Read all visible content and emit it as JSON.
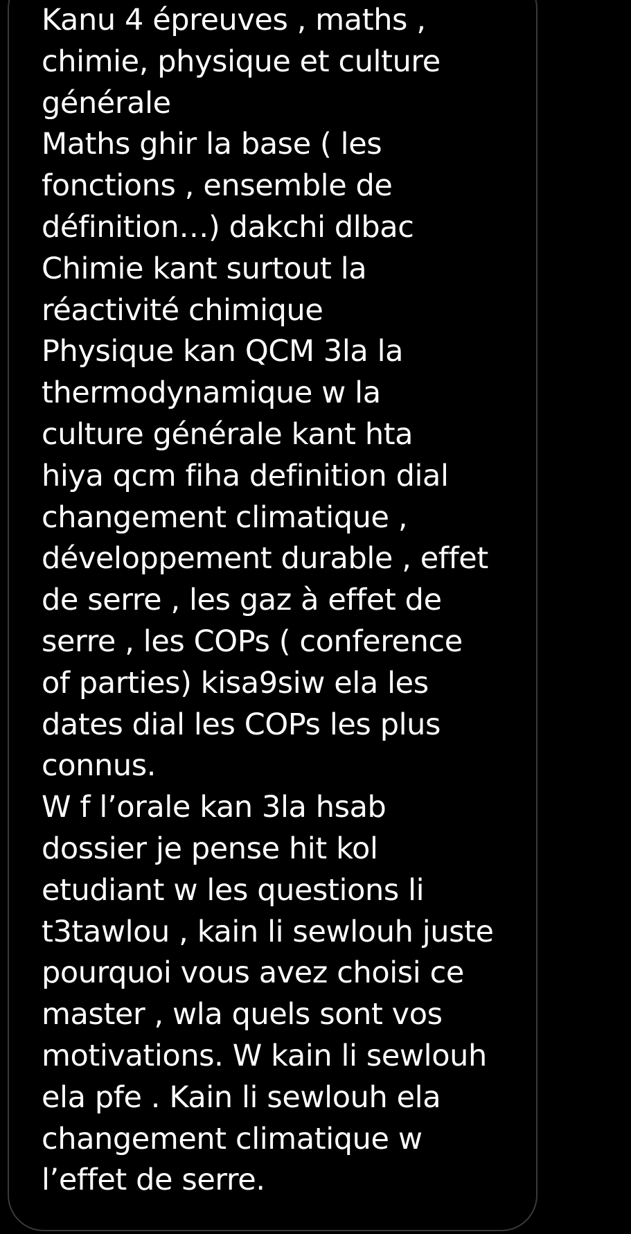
{
  "message": {
    "text": "Kanu 4 épreuves , maths ,\nchimie, physique et culture\ngénérale\nMaths ghir la base ( les\nfonctions , ensemble de\ndéfinition…) dakchi dlbac\nChimie kant surtout la\nréactivité chimique\nPhysique kan QCM 3la la\nthermodynamique w la\nculture générale kant hta\nhiya qcm fiha definition dial\nchangement climatique ,\ndéveloppement durable , effet\nde serre , les gaz à effet de\nserre , les COPs ( conference\nof parties) kisa9siw ela les\ndates dial les COPs les plus\nconnus.\nW f l’orale kan 3la hsab\ndossier je pense hit kol\netudiant w les questions li\nt3tawlou , kain li sewlouh juste\npourquoi vous avez choisi ce\nmaster , wla quels sont vos\nmotivations. W kain li sewlouh\nela pfe . Kain li sewlouh ela\nchangement climatique w\nl’effet de serre."
  },
  "colors": {
    "background": "#000000",
    "text": "#ffffff",
    "bubble_border": "#3a3a3a"
  }
}
